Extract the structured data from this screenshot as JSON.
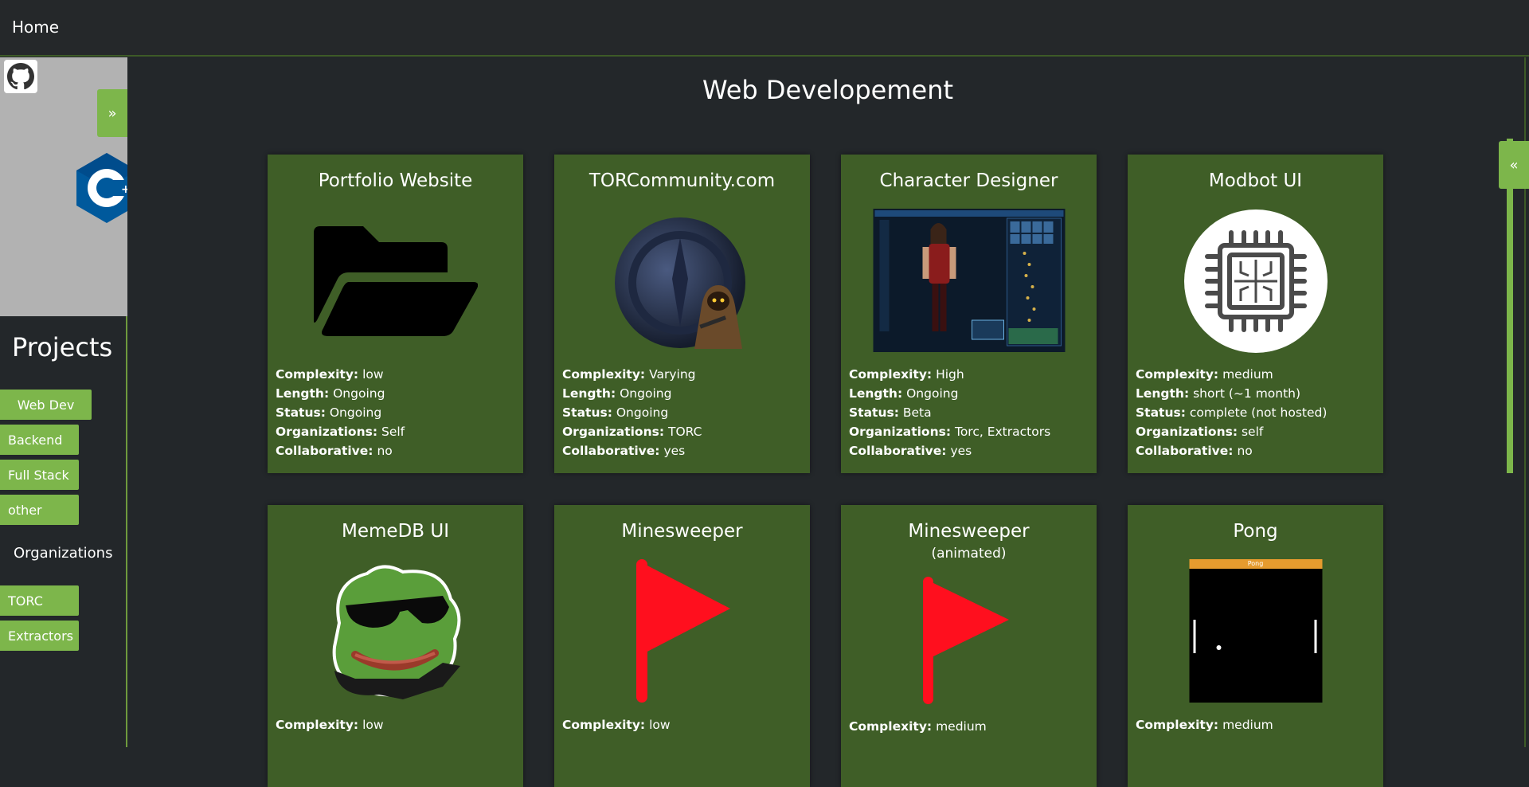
{
  "nav": {
    "home_label": "Home"
  },
  "sidebar": {
    "expand_label": "»",
    "projects_title": "Projects",
    "project_items": [
      "Web Dev",
      "Backend",
      "Full Stack",
      "other"
    ],
    "organizations_title": "Organizations",
    "organization_items": [
      "TORC",
      "Extractors"
    ],
    "active_item": "Web Dev"
  },
  "right_tab": {
    "label": "«"
  },
  "main": {
    "title": "Web Developement",
    "cards": [
      {
        "title": "Portfolio Website",
        "subtitle": "",
        "image": "folder-icon",
        "complexity": "low",
        "length": "Ongoing",
        "status": "Ongoing",
        "organizations": "Self",
        "collaborative": "no"
      },
      {
        "title": "TORCommunity.com",
        "subtitle": "",
        "image": "torc-logo",
        "complexity": "Varying",
        "length": "Ongoing",
        "status": "Ongoing",
        "organizations": "TORC",
        "collaborative": "yes"
      },
      {
        "title": "Character Designer",
        "subtitle": "",
        "image": "character-screenshot",
        "complexity": "High",
        "length": "Ongoing",
        "status": "Beta",
        "organizations": "Torc, Extractors",
        "collaborative": "yes"
      },
      {
        "title": "Modbot UI",
        "subtitle": "",
        "image": "chip-icon",
        "complexity": "medium",
        "length": "short (~1 month)",
        "status": "complete (not hosted)",
        "organizations": "self",
        "collaborative": "no"
      },
      {
        "title": "MemeDB UI",
        "subtitle": "",
        "image": "pepe-image",
        "complexity": "low"
      },
      {
        "title": "Minesweeper",
        "subtitle": "",
        "image": "flag-icon",
        "complexity": "low"
      },
      {
        "title": "Minesweeper",
        "subtitle": "(animated)",
        "image": "flag-icon",
        "complexity": "medium"
      },
      {
        "title": "Pong",
        "subtitle": "",
        "image": "pong-screenshot",
        "complexity": "medium",
        "pong_header": "Pong"
      }
    ],
    "labels": {
      "complexity": "Complexity:",
      "length": "Length:",
      "status": "Status:",
      "organizations": "Organizations:",
      "collaborative": "Collaborative:"
    }
  },
  "colors": {
    "accent": "#7db64b",
    "card_bg": "#3f5e27",
    "page_bg": "#23272a",
    "flag_red": "#ff0f1e"
  }
}
